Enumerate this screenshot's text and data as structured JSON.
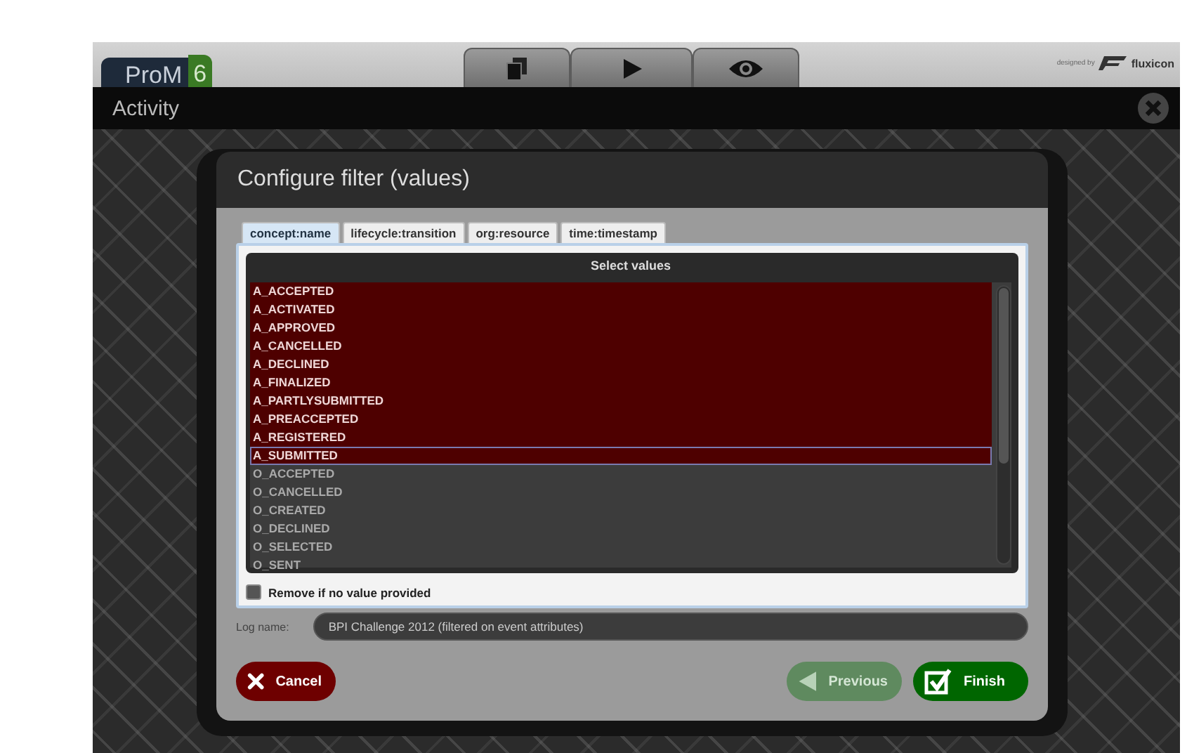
{
  "app": {
    "logo": "ProM",
    "logo_version": "6",
    "credit": "designed by",
    "brand": "fluxicon"
  },
  "toolbar": [
    {
      "kind": "workspace",
      "selected": false
    },
    {
      "kind": "actions",
      "selected": false
    },
    {
      "kind": "views",
      "selected": false
    }
  ],
  "view_title": "Activity",
  "dialog": {
    "title": "Configure filter (values)",
    "tabs": [
      {
        "label": "concept:name",
        "selected": true
      },
      {
        "label": "lifecycle:transition",
        "selected": false
      },
      {
        "label": "org:resource",
        "selected": false
      },
      {
        "label": "time:timestamp",
        "selected": false
      }
    ],
    "list_title": "Select values",
    "values": [
      {
        "label": "A_ACCEPTED",
        "selected": true,
        "focused": false
      },
      {
        "label": "A_ACTIVATED",
        "selected": true,
        "focused": false
      },
      {
        "label": "A_APPROVED",
        "selected": true,
        "focused": false
      },
      {
        "label": "A_CANCELLED",
        "selected": true,
        "focused": false
      },
      {
        "label": "A_DECLINED",
        "selected": true,
        "focused": false
      },
      {
        "label": "A_FINALIZED",
        "selected": true,
        "focused": false
      },
      {
        "label": "A_PARTLYSUBMITTED",
        "selected": true,
        "focused": false
      },
      {
        "label": "A_PREACCEPTED",
        "selected": true,
        "focused": false
      },
      {
        "label": "A_REGISTERED",
        "selected": true,
        "focused": false
      },
      {
        "label": "A_SUBMITTED",
        "selected": true,
        "focused": true
      },
      {
        "label": "O_ACCEPTED",
        "selected": false,
        "focused": false
      },
      {
        "label": "O_CANCELLED",
        "selected": false,
        "focused": false
      },
      {
        "label": "O_CREATED",
        "selected": false,
        "focused": false
      },
      {
        "label": "O_DECLINED",
        "selected": false,
        "focused": false
      },
      {
        "label": "O_SELECTED",
        "selected": false,
        "focused": false
      },
      {
        "label": "O_SENT",
        "selected": false,
        "focused": false
      }
    ],
    "remove_option": {
      "label": "Remove if no value provided",
      "checked": false
    },
    "log_name": {
      "label": "Log name:",
      "value": "BPI Challenge 2012 (filtered on event attributes)"
    },
    "buttons": [
      {
        "kind": "cancel",
        "label": "Cancel",
        "disabled": false
      },
      {
        "kind": "previous",
        "label": "Previous",
        "disabled": true
      },
      {
        "kind": "finish",
        "label": "Finish",
        "disabled": false
      }
    ]
  }
}
